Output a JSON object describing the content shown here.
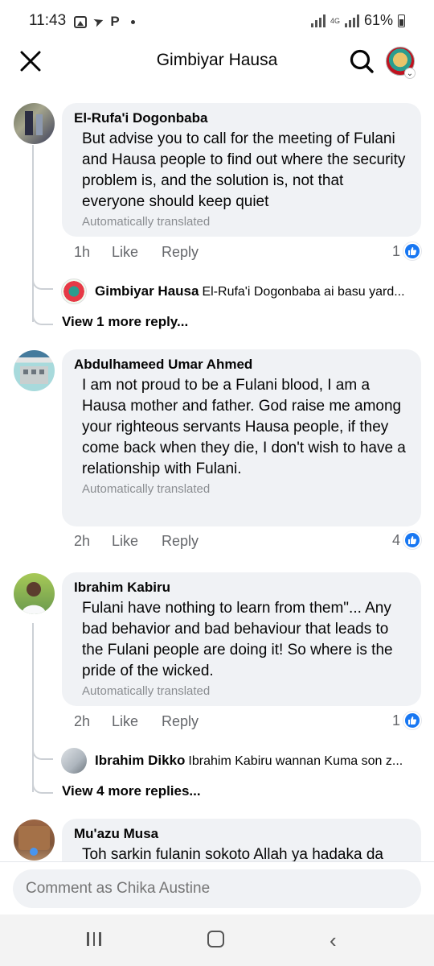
{
  "status_bar": {
    "time": "11:43",
    "p_label": "P",
    "network": "4G",
    "battery": "61%"
  },
  "header": {
    "title": "Gimbiyar Hausa",
    "close_icon": "close-icon",
    "search_icon": "search-icon"
  },
  "comments": [
    {
      "author": "El-Rufa'i Dogonbaba",
      "text": "But advise you to call for the meeting of Fulani and Hausa people to find out where the security problem is, and the solution is, not that everyone should keep quiet",
      "translated": "Automatically translated",
      "time": "1h",
      "like": "Like",
      "reply": "Reply",
      "reactions": "1",
      "reply_preview": {
        "author": "Gimbiyar Hausa",
        "text": "El-Rufa'i Dogonbaba ai basu yard..."
      },
      "view_more": "View 1 more reply..."
    },
    {
      "author": "Abdulhameed Umar Ahmed",
      "text": "I am not proud to be a Fulani blood, I am a Hausa mother and father. God raise me among your righteous servants Hausa people, if they come back when they die, I don't wish to have a relationship with Fulani.",
      "translated": "Automatically translated",
      "time": "2h",
      "like": "Like",
      "reply": "Reply",
      "reactions": "4"
    },
    {
      "author": "Ibrahim Kabiru",
      "text": "Fulani have nothing to learn from them\"... Any bad behavior and bad behaviour that leads to the Fulani people are doing it! So where is the pride of the wicked.",
      "translated": "Automatically translated",
      "time": "2h",
      "like": "Like",
      "reply": "Reply",
      "reactions": "1",
      "reply_preview": {
        "author": "Ibrahim Dikko",
        "text": "Ibrahim Kabiru wannan Kuma son z..."
      },
      "view_more": "View 4 more replies..."
    },
    {
      "author": "Mu'azu Musa",
      "text": "Toh sarkin fulanin sokoto Allah ya hadaka da"
    }
  ],
  "composer": {
    "placeholder": "Comment as Chika Austine"
  },
  "colors": {
    "accent": "#1877f2",
    "bubble": "#f0f2f5",
    "meta": "#65676b"
  }
}
